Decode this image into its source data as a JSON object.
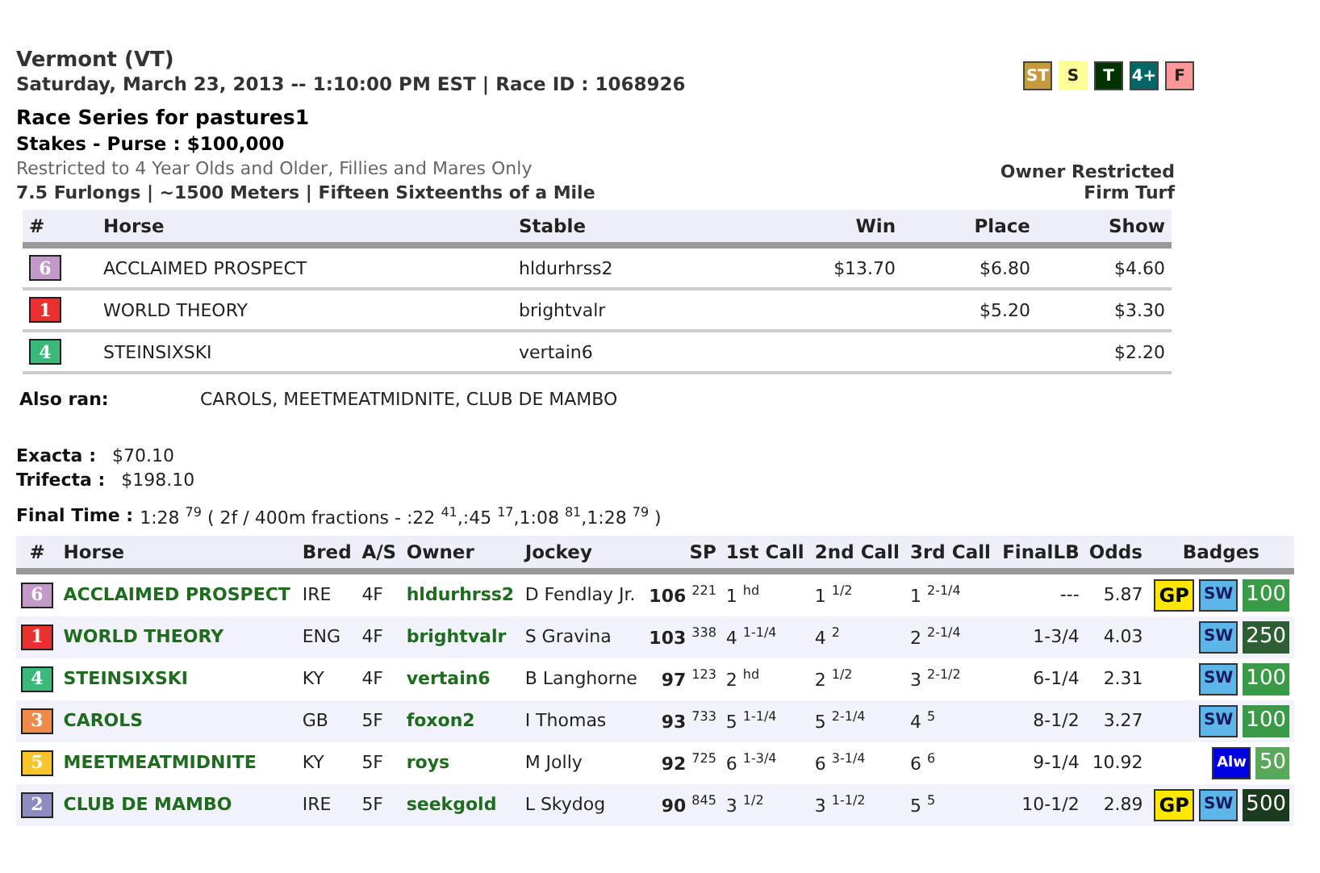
{
  "track": "Vermont (VT)",
  "race_info": "Saturday, March 23, 2013 -- 1:10:00 PM EST | Race ID : 1068926",
  "condition_tags": [
    {
      "text": "ST",
      "color": "#c49a3c"
    },
    {
      "text": "S",
      "color": "#ffff99"
    },
    {
      "text": "T",
      "color": "#003300"
    },
    {
      "text": "4+",
      "color": "#006666"
    },
    {
      "text": "F",
      "color": "#ff9999"
    }
  ],
  "race_name": "Race Series for pastures1",
  "purse": "Stakes - Purse : $100,000",
  "restrictions": "Restricted to 4 Year Olds and Older, Fillies and Mares Only",
  "distance": "7.5 Furlongs | ~1500 Meters | Fifteen Sixteenths of a Mile",
  "owner_restriction": "Owner Restricted",
  "surface": "Firm Turf",
  "payouts": {
    "columns": [
      "#",
      "Horse",
      "Stable",
      "Win",
      "Place",
      "Show"
    ],
    "rows": [
      {
        "post": "6",
        "color": "#c399c9",
        "horse": "ACCLAIMED PROSPECT",
        "stable": "hldurhrss2",
        "win": "$13.70",
        "place": "$6.80",
        "show": "$4.60"
      },
      {
        "post": "1",
        "color": "#e8312f",
        "horse": "WORLD THEORY",
        "stable": "brightvalr",
        "place": "$5.20",
        "show": "$3.30"
      },
      {
        "post": "4",
        "color": "#3cb97a",
        "horse": "STEINSIXSKI",
        "stable": "vertain6",
        "show": "$2.20"
      }
    ]
  },
  "also_ran": {
    "label": "Also ran:",
    "value": "CAROLS, MEETMEATMIDNITE, CLUB DE MAMBO"
  },
  "exotics": [
    {
      "label": "Exacta :",
      "value": "$70.10"
    },
    {
      "label": "Trifecta :",
      "value": "$198.10"
    }
  ],
  "final_time": {
    "label": "Final Time :",
    "value": "1:28 $^{79}$  ( 2f / 400m fractions - :22 $^{41}$,:45 $^{17}$,1:08 $^{81}$,1:28 $^{79}$ )"
  },
  "results": {
    "columns": [
      "#",
      "Horse",
      "Bred",
      "A/S",
      "Owner",
      "Jockey",
      "SP",
      "1st Call",
      "2nd Call",
      "3rd Call",
      "FinalLB",
      "Odds",
      "Badges"
    ],
    "rows": [
      {
        "post": "6",
        "color": "#c399c9",
        "horse": "ACCLAIMED PROSPECT",
        "bred": "IRE",
        "age_sex": "4F",
        "owner": "hldurhrss2",
        "jockey": "D Fendlay Jr.",
        "sp": "**106** $^{221}$",
        "call_1": "1 $^{hd}$",
        "call_2": "1 $^{1/2}$",
        "call_3": "1 $^{2-1/4}$",
        "final_lb": "---",
        "odds": "5.87",
        "badges": [
          {
            "kind": "gp",
            "text": "GP"
          },
          {
            "kind": "sw",
            "text": "SW"
          },
          {
            "kind": "earnings",
            "text": "100",
            "color": "#3a9a48"
          }
        ]
      },
      {
        "post": "1",
        "color": "#e8312f",
        "horse": "WORLD THEORY",
        "bred": "ENG",
        "age_sex": "4F",
        "owner": "brightvalr",
        "jockey": "S Gravina",
        "sp": "**103** $^{338}$",
        "call_1": "4 $^{1-1/4}$",
        "call_2": "4 $^{2}$",
        "call_3": "2 $^{2-1/4}$",
        "final_lb": "1-3/4",
        "odds": "4.03",
        "badges": [
          {
            "kind": "sw",
            "text": "SW"
          },
          {
            "kind": "earnings",
            "text": "250",
            "color": "#2e5e32"
          }
        ]
      },
      {
        "post": "4",
        "color": "#3cb97a",
        "horse": "STEINSIXSKI",
        "bred": "KY",
        "age_sex": "4F",
        "owner": "vertain6",
        "jockey": "B Langhorne",
        "sp": "**97** $^{123}$",
        "call_1": "2 $^{hd}$",
        "call_2": "2 $^{1/2}$",
        "call_3": "3 $^{2-1/2}$",
        "final_lb": "6-1/4",
        "odds": "2.31",
        "badges": [
          {
            "kind": "sw",
            "text": "SW"
          },
          {
            "kind": "earnings",
            "text": "100",
            "color": "#3a9a48"
          }
        ]
      },
      {
        "post": "3",
        "color": "#f08a4b",
        "horse": "CAROLS",
        "bred": "GB",
        "age_sex": "5F",
        "owner": "foxon2",
        "jockey": "I Thomas",
        "sp": "**93** $^{733}$",
        "call_1": "5 $^{1-1/4}$",
        "call_2": "5 $^{2-1/4}$",
        "call_3": "4 $^{5}$",
        "final_lb": "8-1/2",
        "odds": "3.27",
        "badges": [
          {
            "kind": "sw",
            "text": "SW"
          },
          {
            "kind": "earnings",
            "text": "100",
            "color": "#3a9a48"
          }
        ]
      },
      {
        "post": "5",
        "color": "#f7c52a",
        "horse": "MEETMEATMIDNITE",
        "bred": "KY",
        "age_sex": "5F",
        "owner": "roys",
        "jockey": "M Jolly",
        "sp": "**92** $^{725}$",
        "call_1": "6 $^{1-3/4}$",
        "call_2": "6 $^{3-1/4}$",
        "call_3": "6 $^{6}$",
        "final_lb": "9-1/4",
        "odds": "10.92",
        "badges": [
          {
            "kind": "alw",
            "text": "Alw"
          },
          {
            "kind": "earnings",
            "text": "50",
            "color": "#5aa85a"
          }
        ]
      },
      {
        "post": "2",
        "color": "#8c8cc0",
        "horse": "CLUB DE MAMBO",
        "bred": "IRE",
        "age_sex": "5F",
        "owner": "seekgold",
        "jockey": "L Skydog",
        "sp": "**90** $^{845}$",
        "call_1": "3 $^{1/2}$",
        "call_2": "3 $^{1-1/2}$",
        "call_3": "5 $^{5}$",
        "final_lb": "10-1/2",
        "odds": "2.89",
        "badges": [
          {
            "kind": "gp",
            "text": "GP"
          },
          {
            "kind": "sw",
            "text": "SW"
          },
          {
            "kind": "earnings",
            "text": "500",
            "color": "#1c3a1e"
          }
        ]
      }
    ]
  }
}
